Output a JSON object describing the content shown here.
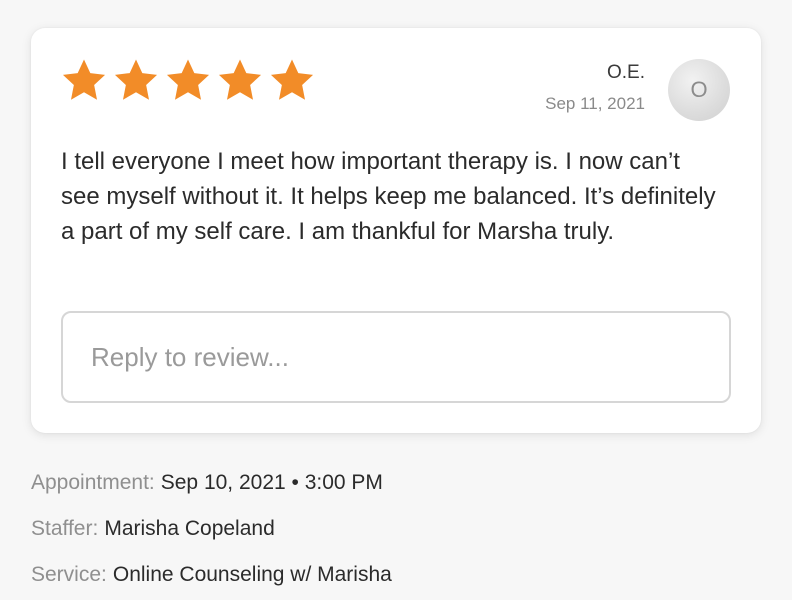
{
  "review": {
    "rating": 5,
    "max_rating": 5,
    "star_color": "#f28c28",
    "author": "O.E.",
    "date": "Sep 11, 2021",
    "avatar_initial": "O",
    "text": "I tell everyone I meet how important therapy is. I now can’t see myself without it. It helps keep me balanced. It’s definitely a part of my self care. I am thankful for Marsha truly.",
    "reply_placeholder": "Reply to review...",
    "reply_value": ""
  },
  "details": {
    "appointment_label": "Appointment:",
    "appointment_value": "Sep 10, 2021 • 3:00 PM",
    "staffer_label": "Staffer:",
    "staffer_value": "Marisha Copeland",
    "service_label": "Service:",
    "service_value": "Online Counseling w/ Marisha"
  }
}
